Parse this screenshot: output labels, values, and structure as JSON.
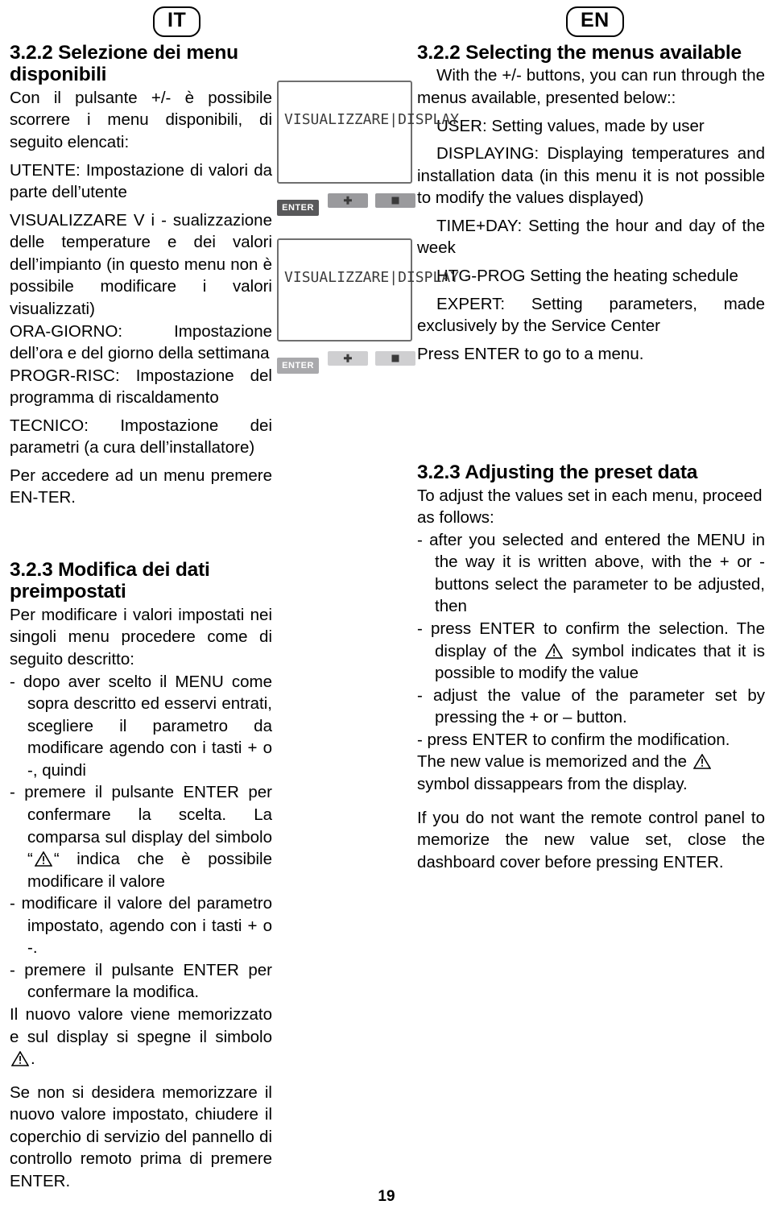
{
  "languages": {
    "it": "IT",
    "en": "EN"
  },
  "page_number": "19",
  "it": {
    "s322_title": "3.2.2 Selezione dei menu disponibili",
    "s322_intro": "Con il pulsante +/- è possibile scorrere i menu disponibili, di seguito elencati:",
    "s322_item_utente": "UTENTE: Impostazione di valori da parte dell’utente",
    "s322_item_visualizzare": "VISUALIZZARE                V i - sualizzazione delle temperature e dei valori dell’impianto (in questo menu non è possibile modificare i valori visualizzati)",
    "s322_item_oragiorno": "ORA-GIORNO:   Impostazione dell’ora e del giorno della settimana",
    "s322_item_progrisc": "PROGR-RISC:   Impostazione del programma di riscaldamento",
    "s322_item_tecnico": "TECNICO: Impostazione dei parametri (a cura dell’installatore)",
    "s322_outro": "Per accedere ad un menu premere EN-TER.",
    "s323_title": "3.2.3 Modifica dei dati preimpostati",
    "s323_intro": "Per modificare i valori impostati nei singoli menu procedere come di seguito descritto:",
    "s323_b1": "- dopo aver scelto il MENU come sopra descritto ed esservi entrati, scegliere il parametro da modificare  agendo con i tasti  + o -, quindi",
    "s323_b2_a": "- premere il pulsante ENTER per confermare la scelta. La comparsa sul display del simbolo “",
    "s323_b2_b": "“ indica che è possibile modificare il valore",
    "s323_b3": "- modificare il valore del parametro impostato, agendo  con i tasti + o -.",
    "s323_b4": "- premere il pulsante ENTER per confermare la modifica.",
    "s323_p_a": "Il nuovo  valore viene memorizzato e sul display  si  spegne il simbolo ",
    "s323_p_b": ".",
    "s323_last": "Se non si desidera memorizzare il nuovo valore impostato,  chiudere il coperchio di servizio del pannello  di controllo remoto prima di premere ENTER."
  },
  "en": {
    "s322_title": "3.2.2 Selecting the menus available",
    "s322_intro": "With the +/- buttons, you can run through the menus available, presented below::",
    "s322_item_user": "USER:  Setting  values,  made by user",
    "s322_item_displaying": "DISPLAYING: Displaying temperatures and installation data (in this menu it is not possible to modify the values displayed)",
    "s322_item_timeday": "TIME+DAY:  Setting  the  hour and day of the week",
    "s322_item_htgprog": "HTG-PROG  Setting  the  heating schedule",
    "s322_item_expert": "EXPERT:  Setting  parameters, made exclusively by the Service Center",
    "s322_outro": "Press ENTER to go to a menu.",
    "s323_title": "3.2.3 Adjusting the preset data",
    "s323_intro": "To adjust the values set in each menu, proceed as follows:",
    "s323_b1": "- after you selected and entered the MENU in the way it is written above, with the + or - buttons select the parameter to be adjusted, then",
    "s323_b2_a": "- press ENTER to confirm the selection. The display of the ",
    "s323_b2_b": " symbol indicates that it is possible to modify the value",
    "s323_b3": "- adjust the value of the parameter set by pressing the + or – button.",
    "s323_b4": "- press ENTER to confirm the modification.",
    "s323_p_a": "The new value is memorized and the ",
    "s323_p_b": "symbol dissappears from the display.",
    "s323_last": "If you do not want the remote control panel to memorize the new value set, close the dashboard cover before pressing ENTER."
  },
  "device": {
    "display_1_text": "VISUALIZZARE|DISPLAY",
    "display_2_text": "VISUALIZZARE|DISPLAY",
    "enter_label_1": "ENTER",
    "enter_label_2": "ENTER",
    "plus_label": "+",
    "minus_label": "-"
  }
}
